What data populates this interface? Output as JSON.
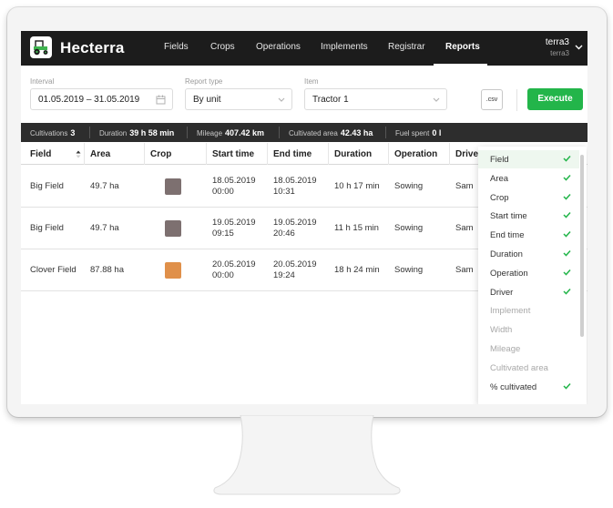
{
  "app": {
    "title": "Hecterra"
  },
  "nav": [
    {
      "label": "Fields"
    },
    {
      "label": "Crops"
    },
    {
      "label": "Operations"
    },
    {
      "label": "Implements"
    },
    {
      "label": "Registrar"
    },
    {
      "label": "Reports",
      "active": true
    }
  ],
  "user": {
    "name": "terra3",
    "account": "terra3"
  },
  "filters": {
    "interval": {
      "label": "Interval",
      "value": "01.05.2019 – 31.05.2019"
    },
    "report_type": {
      "label": "Report type",
      "value": "By unit"
    },
    "item": {
      "label": "Item",
      "value": "Tractor 1"
    },
    "csv_label": ".csv",
    "execute_label": "Execute"
  },
  "stats": [
    {
      "label": "Cultivations",
      "value": "3"
    },
    {
      "label": "Duration",
      "value": "39 h 58 min"
    },
    {
      "label": "Mileage",
      "value": "407.42 km"
    },
    {
      "label": "Cultivated area",
      "value": "42.43 ha"
    },
    {
      "label": "Fuel spent",
      "value": "0 l"
    }
  ],
  "table": {
    "columns": [
      "Field",
      "Area",
      "Crop",
      "Start time",
      "End time",
      "Duration",
      "Operation",
      "Driver"
    ],
    "rows": [
      {
        "field": "Big Field",
        "area": "49.7 ha",
        "crop_color": "#7d7070",
        "start_date": "18.05.2019",
        "start_time": "00:00",
        "end_date": "18.05.2019",
        "end_time": "10:31",
        "duration": "10 h 17 min",
        "operation": "Sowing",
        "driver": "Sam"
      },
      {
        "field": "Big Field",
        "area": "49.7 ha",
        "crop_color": "#7d7070",
        "start_date": "19.05.2019",
        "start_time": "09:15",
        "end_date": "19.05.2019",
        "end_time": "20:46",
        "duration": "11 h 15 min",
        "operation": "Sowing",
        "driver": "Sam"
      },
      {
        "field": "Clover Field",
        "area": "87.88 ha",
        "crop_color": "#e0904a",
        "start_date": "20.05.2019",
        "start_time": "00:00",
        "end_date": "20.05.2019",
        "end_time": "19:24",
        "duration": "18 h 24 min",
        "operation": "Sowing",
        "driver": "Sam"
      }
    ]
  },
  "column_menu": {
    "items": [
      {
        "label": "Field",
        "checked": true
      },
      {
        "label": "Area",
        "checked": true
      },
      {
        "label": "Crop",
        "checked": true
      },
      {
        "label": "Start time",
        "checked": true
      },
      {
        "label": "End time",
        "checked": true
      },
      {
        "label": "Duration",
        "checked": true
      },
      {
        "label": "Operation",
        "checked": true
      },
      {
        "label": "Driver",
        "checked": true
      },
      {
        "label": "Implement",
        "checked": false
      },
      {
        "label": "Width",
        "checked": false
      },
      {
        "label": "Mileage",
        "checked": false
      },
      {
        "label": "Cultivated area",
        "checked": false
      },
      {
        "label": "% cultivated",
        "checked": true
      }
    ]
  },
  "colors": {
    "accent": "#23b54a",
    "header_bg": "#1c1c1c",
    "statbar_bg": "#2d2d2d"
  }
}
